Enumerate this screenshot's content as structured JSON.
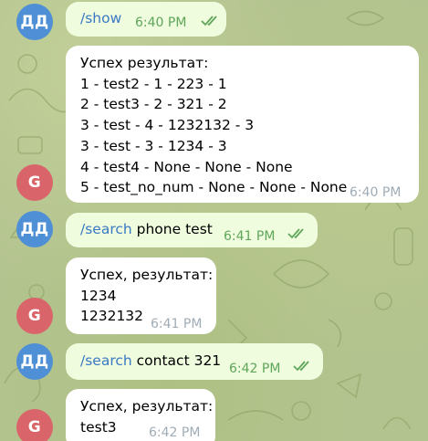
{
  "chat": {
    "messages": [
      {
        "sender": "ДД",
        "text_cmd": "/show",
        "text_rest": "",
        "time": "6:40 PM",
        "status": "read"
      },
      {
        "sender": "G",
        "lines": [
          "Успех результат:",
          "1 - test2 - 1 - 223 - 1",
          "2 - test3 - 2 - 321 - 2",
          "3 - test - 4 - 1232132 - 3",
          "3 - test - 3 - 1234 - 3",
          "4 - test4 - None - None - None",
          "5 - test_no_num - None - None - None"
        ],
        "time": "6:40 PM"
      },
      {
        "sender": "ДД",
        "text_cmd": "/search",
        "text_rest": " phone test",
        "time": "6:41 PM",
        "status": "read"
      },
      {
        "sender": "G",
        "lines": [
          "Успех, результат:",
          "1234",
          "1232132"
        ],
        "time": "6:41 PM"
      },
      {
        "sender": "ДД",
        "text_cmd": "/search",
        "text_rest": " contact 321",
        "time": "6:42 PM",
        "status": "read"
      },
      {
        "sender": "G",
        "lines": [
          "Успех, результат:",
          "test3"
        ],
        "time": "6:42 PM"
      }
    ]
  },
  "colors": {
    "outgoing_bubble": "#effdde",
    "incoming_bubble": "#ffffff",
    "avatar_user": "#4e8fd6",
    "avatar_bot": "#d9646a",
    "command_link": "#3a79c4",
    "read_checks": "#5fa55a"
  },
  "icons": {
    "read_status": "double-check-icon"
  }
}
